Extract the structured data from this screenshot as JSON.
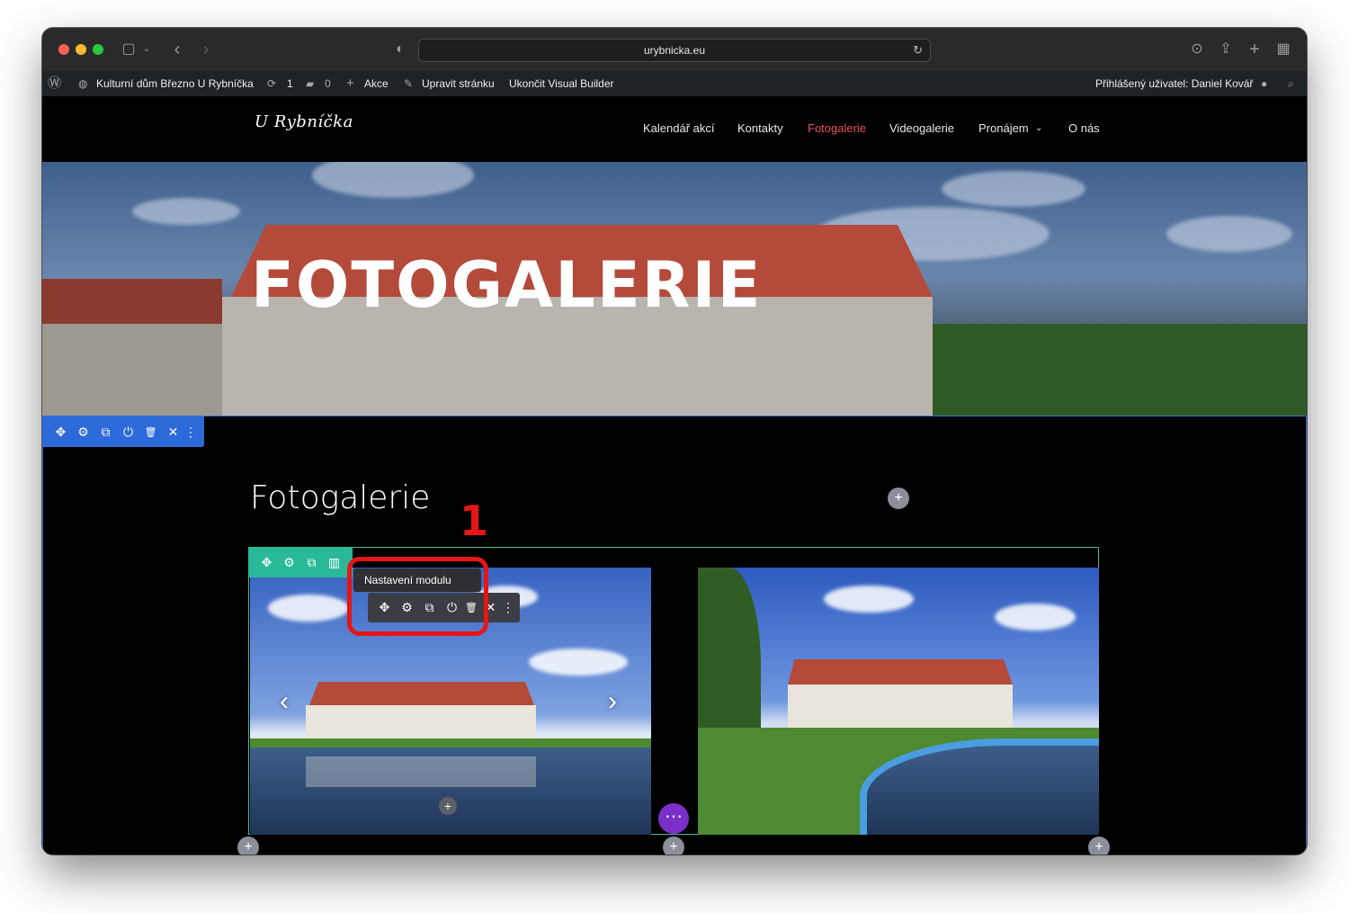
{
  "browser": {
    "url": "urybnicka.eu"
  },
  "wp_admin_bar": {
    "site_name": "Kulturní dům Březno U Rybníčka",
    "updates_count": "1",
    "comments_count": "0",
    "new_label": "Akce",
    "edit_page": "Upravit stránku",
    "exit_builder": "Ukončit Visual Builder",
    "logged_in_user": "Přihlášený uživatel: Daniel Kovář"
  },
  "site": {
    "logo_text": "U Rybníčka",
    "nav": [
      {
        "label": "Kalendář akcí"
      },
      {
        "label": "Kontakty"
      },
      {
        "label": "Fotogalerie"
      },
      {
        "label": "Videogalerie"
      },
      {
        "label": "Pronájem"
      },
      {
        "label": "O nás"
      }
    ],
    "active_nav": "Fotogalerie",
    "active_color": "#e8535a"
  },
  "hero": {
    "title": "FOTOGALERIE"
  },
  "section": {
    "title": "Fotogalerie"
  },
  "module": {
    "tooltip": "Nastavení modulu"
  },
  "annotation": {
    "number": "1",
    "color": "#e41616"
  },
  "builder_colors": {
    "section_toolbar": "#2d6ad9",
    "row_toolbar": "#29b999",
    "module_toolbar": "#3c3d44",
    "page_settings_button": "#7a2fc9"
  },
  "icons": {
    "move": "✥",
    "settings": "⚙",
    "duplicate": "⧉",
    "power": "⏻",
    "delete": "🗑",
    "close": "✕",
    "more": "⋮",
    "columns": "▥",
    "add": "+"
  }
}
